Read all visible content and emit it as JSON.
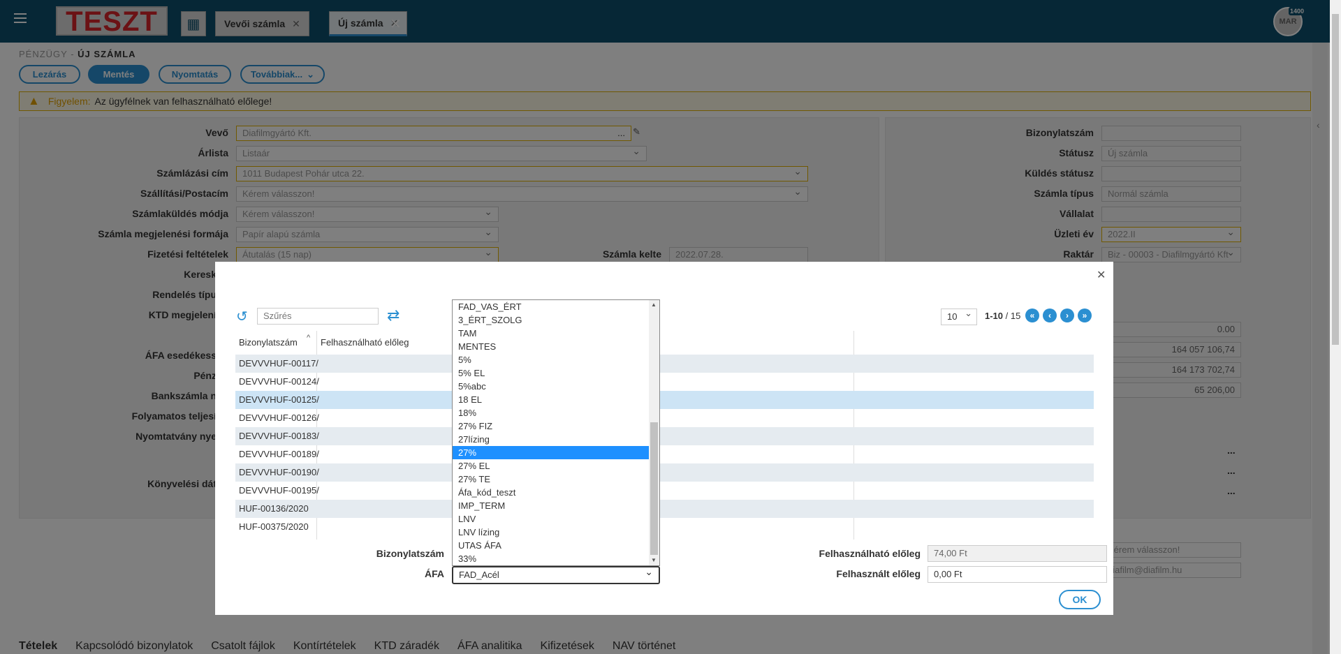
{
  "app": {
    "logo": "TESZT",
    "tabs": [
      {
        "label": "Vevői számla"
      },
      {
        "label": "Új számla"
      }
    ],
    "avatar_text": "MAR",
    "avatar_badge": "1400"
  },
  "breadcrumb": {
    "section": "PÉNZÜGY",
    "separator": " - ",
    "page": "ÚJ SZÁMLA"
  },
  "actions": {
    "close": "Lezárás",
    "save": "Mentés",
    "print": "Nyomtatás",
    "more": "Továbbiak..."
  },
  "warning": {
    "label": "Figyelem:",
    "text": "Az ügyfélnek van felhasználható előlege!"
  },
  "form_left": [
    {
      "label": "Vevő",
      "value": "Diafilmgyártó Kft.",
      "extra": "..."
    },
    {
      "label": "Árlista",
      "value": "Listaár"
    },
    {
      "label": "Számlázási cím",
      "value": "1011 Budapest Pohár utca 22."
    },
    {
      "label": "Szállítási/Postacím",
      "value": "Kérem válasszon!"
    },
    {
      "label": "Számlaküldés módja",
      "value": "Kérem válasszon!"
    },
    {
      "label": "Számla megjelenési formája",
      "value": "Papír alapú számla"
    },
    {
      "label": "Fizetési feltételek",
      "value": "Átutalás (15 nap)"
    }
  ],
  "form_left_lower": [
    "Keresk",
    "Rendelés típu",
    "KTD megjelení",
    "ÁFA esedékess",
    "Pénz",
    "Bankszámla n",
    "Folyamatos teljesí",
    "Nyomtatvány nye",
    "Könyvelési dát"
  ],
  "invoice_date": {
    "label": "Számla kelte",
    "value": "2022.07.28."
  },
  "form_right": [
    {
      "label": "Bizonylatszám",
      "value": ""
    },
    {
      "label": "Státusz",
      "value": "Új számla"
    },
    {
      "label": "Küldés státusz",
      "value": ""
    },
    {
      "label": "Számla típus",
      "value": "Normál számla"
    },
    {
      "label": "Vállalat",
      "value": ""
    },
    {
      "label": "Üzleti év",
      "value": "2022.II"
    },
    {
      "label": "Raktár",
      "value": "Biz - 00003 - Diafilmgyártó Kft"
    }
  ],
  "right_values": [
    "0.00",
    "164 057 106,74",
    "164 173 702,74",
    "65 206,00"
  ],
  "right_more": [
    "...",
    "...",
    "..."
  ],
  "right_lower": [
    "Kérem válasszon!",
    "diafilm@diafilm.hu"
  ],
  "bottom_tabs": [
    "Tételek",
    "Kapcsolódó bizonylatok",
    "Csatolt fájlok",
    "Kontírtételek",
    "KTD záradék",
    "ÁFA analitika",
    "Kifizetések",
    "NAV történet"
  ],
  "modal": {
    "filter_placeholder": "Szűrés",
    "per_page": "10",
    "paging": {
      "range": "1-10",
      "separator": " / ",
      "total": "15"
    },
    "columns": [
      "Bizonylatszám",
      "Felhasználható előleg"
    ],
    "rows": [
      "DEVVVHUF-00117/",
      "DEVVVHUF-00124/",
      "DEVVVHUF-00125/",
      "DEVVVHUF-00126/",
      "DEVVVHUF-00183/",
      "DEVVVHUF-00189/",
      "DEVVVHUF-00190/",
      "DEVVVHUF-00195/",
      "HUF-00136/2020",
      "HUF-00375/2020"
    ],
    "selected_row": 2,
    "fields": {
      "doc_label": "Bizonylatszám",
      "afa_label": "ÁFA",
      "afa_value": "FAD_Acél",
      "avail_label": "Felhasználható előleg",
      "avail_value": "74,00 Ft",
      "used_label": "Felhasznált előleg",
      "used_value": "0,00 Ft"
    },
    "ok": "OK",
    "afa_options": [
      "FAD_VAS_ÉRT",
      "3_ÉRT_SZOLG",
      "TAM",
      "MENTES",
      "5%",
      "5% EL",
      "5%abc",
      "18 EL",
      "18%",
      "27% FIZ",
      "27lízing",
      "27%",
      "27% EL",
      "27% TE",
      "Áfa_kód_teszt",
      "IMP_TERM",
      "LNV",
      "LNV lízing",
      "UTAS ÁFA",
      "33%"
    ],
    "afa_selected": "27%"
  },
  "colors": {
    "topbar": "#0d4f6c",
    "accent": "#2b8fd1",
    "warning": "#e0a000",
    "logo_red": "#d6252a",
    "option_selected": "#1e90ff"
  }
}
